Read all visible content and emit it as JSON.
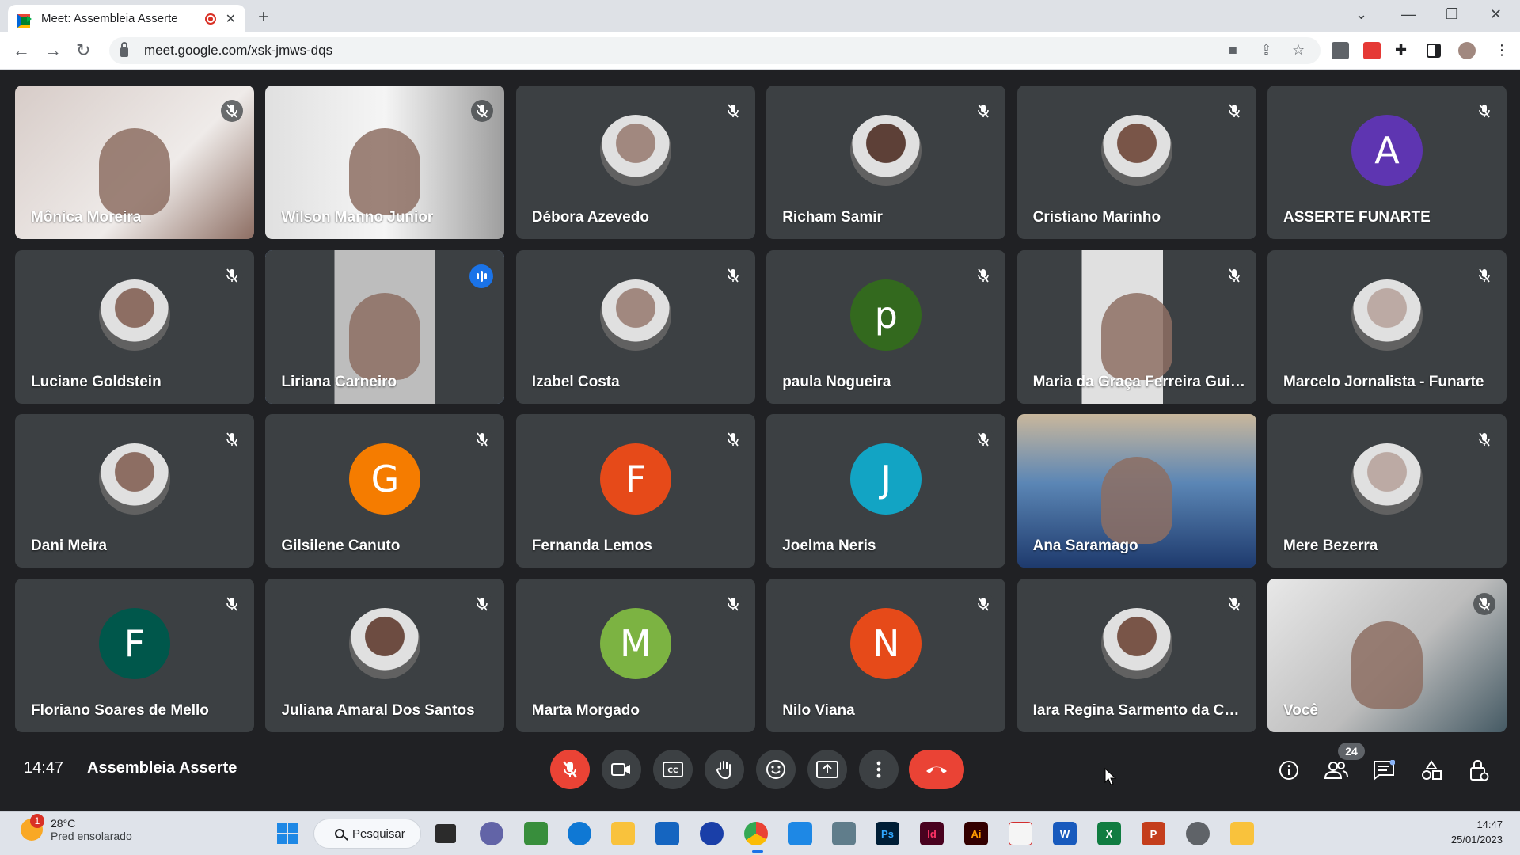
{
  "browser": {
    "tab_title": "Meet: Assembleia Asserte",
    "url": "meet.google.com/xsk-jmws-dqs"
  },
  "participants": [
    {
      "name": "Mônica Moreira",
      "avatar": "video",
      "muted": true
    },
    {
      "name": "Wilson Manno Junior",
      "avatar": "video",
      "muted": true
    },
    {
      "name": "Débora Azevedo",
      "avatar": "photo",
      "muted": true
    },
    {
      "name": "Richam Samir",
      "avatar": "photo",
      "muted": true
    },
    {
      "name": "Cristiano Marinho",
      "avatar": "photo",
      "muted": true
    },
    {
      "name": "ASSERTE FUNARTE",
      "avatar": "letter",
      "letter": "A",
      "color": "#5e35b1",
      "muted": true
    },
    {
      "name": "Luciane Goldstein",
      "avatar": "photo",
      "muted": true
    },
    {
      "name": "Liriana Carneiro",
      "avatar": "video",
      "muted": false,
      "speaking": true
    },
    {
      "name": "Izabel Costa",
      "avatar": "photo",
      "muted": true
    },
    {
      "name": "paula Nogueira",
      "avatar": "letter",
      "letter": "p",
      "color": "#33691e",
      "muted": true
    },
    {
      "name": "Maria da Graça Ferreira Guim...",
      "avatar": "video",
      "muted": true
    },
    {
      "name": "Marcelo Jornalista - Funarte",
      "avatar": "photo",
      "muted": true
    },
    {
      "name": "Dani Meira",
      "avatar": "photo",
      "muted": true
    },
    {
      "name": "Gilsilene Canuto",
      "avatar": "letter",
      "letter": "G",
      "color": "#f57c00",
      "muted": true
    },
    {
      "name": "Fernanda Lemos",
      "avatar": "letter",
      "letter": "F",
      "color": "#e64a19",
      "muted": true
    },
    {
      "name": "Joelma Neris",
      "avatar": "letter",
      "letter": "J",
      "color": "#12a4c4",
      "muted": true
    },
    {
      "name": "Ana Saramago",
      "avatar": "video",
      "muted": false
    },
    {
      "name": "Mere Bezerra",
      "avatar": "photo",
      "muted": true
    },
    {
      "name": "Floriano Soares de Mello",
      "avatar": "letter",
      "letter": "F",
      "color": "#00574b",
      "muted": true
    },
    {
      "name": "Juliana Amaral Dos Santos",
      "avatar": "photo",
      "muted": true
    },
    {
      "name": "Marta Morgado",
      "avatar": "letter",
      "letter": "M",
      "color": "#7cb342",
      "muted": true
    },
    {
      "name": "Nilo Viana",
      "avatar": "letter",
      "letter": "N",
      "color": "#e64a19",
      "muted": true
    },
    {
      "name": "Iara Regina Sarmento da Costa",
      "avatar": "photo",
      "muted": true
    },
    {
      "name": "Você",
      "avatar": "video",
      "muted": true
    }
  ],
  "meeting": {
    "time": "14:47",
    "name": "Assembleia Asserte",
    "people_count": "24"
  },
  "taskbar": {
    "weather_temp": "28°C",
    "weather_desc": "Pred ensolarado",
    "weather_badge": "1",
    "search_label": "Pesquisar",
    "clock_time": "14:47",
    "clock_date": "25/01/2023"
  },
  "colors": {
    "meet_bg": "#202124",
    "tile_bg": "#3c4043",
    "accent_red": "#ea4335",
    "speaking_blue": "#8ab4f8"
  }
}
